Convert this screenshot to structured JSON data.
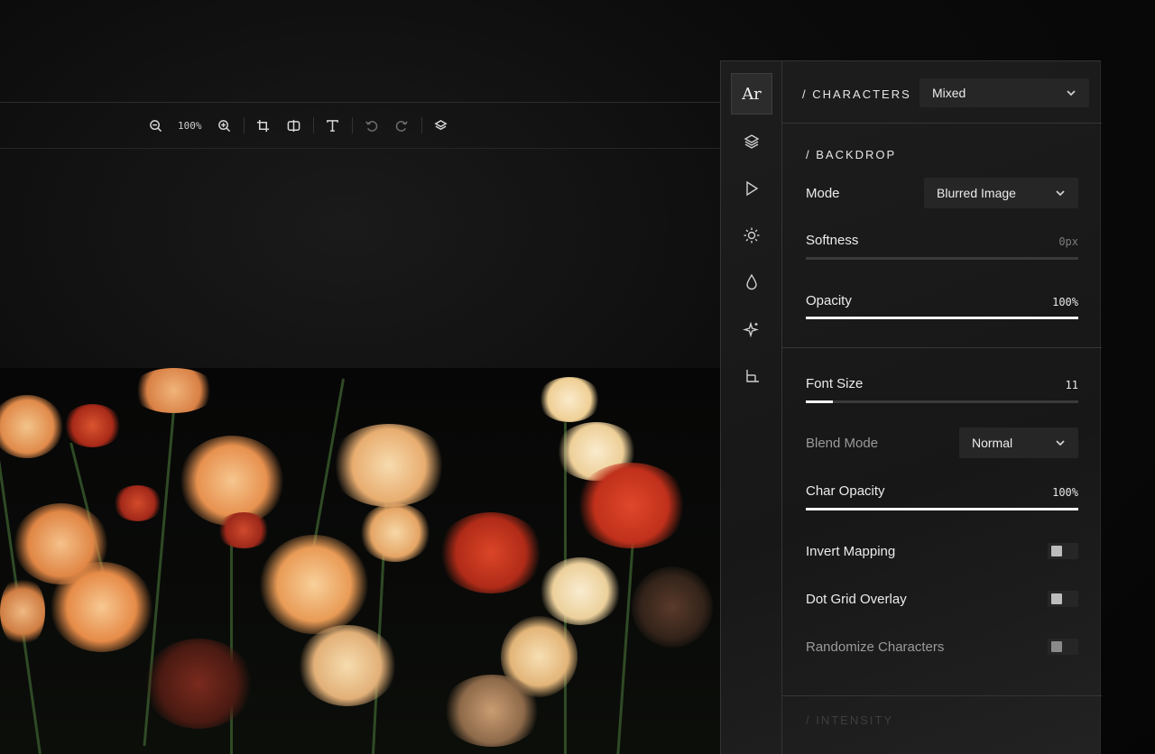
{
  "toolbar": {
    "zoom_level": "100%",
    "buttons": [
      "zoom-out",
      "zoom-in",
      "crop",
      "split-compare",
      "text",
      "undo",
      "redo",
      "layers"
    ]
  },
  "rail": {
    "items": [
      "characters",
      "layers",
      "play",
      "brightness",
      "color-drop",
      "effects",
      "crop-frame"
    ],
    "characters_glyph": "Ar"
  },
  "characters": {
    "title": "/ CHARACTERS",
    "select_value": "Mixed"
  },
  "backdrop": {
    "title": "/ BACKDROP",
    "mode_label": "Mode",
    "mode_value": "Blurred Image",
    "softness_label": "Softness",
    "softness_value": "0px",
    "softness_level": 0,
    "opacity_label": "Opacity",
    "opacity_value": "100%",
    "opacity_level": 1.0
  },
  "chars": {
    "font_size_label": "Font Size",
    "font_size_value": "11",
    "font_size_level": 0.1,
    "blend_mode_label": "Blend Mode",
    "blend_mode_value": "Normal",
    "char_opacity_label": "Char Opacity",
    "char_opacity_value": "100%",
    "char_opacity_level": 1.0,
    "invert_label": "Invert Mapping",
    "invert_on": false,
    "dot_grid_label": "Dot Grid Overlay",
    "dot_grid_on": false,
    "randomize_label": "Randomize Characters",
    "randomize_on": false
  },
  "intensity": {
    "title": "/ INTENSITY"
  },
  "colors": {
    "panel_bg": "#1b1b1b",
    "accent": "#f4f4f4",
    "flower_orange": "#e8985a",
    "flower_red": "#c8321f",
    "flower_cream": "#f1d7a8"
  }
}
